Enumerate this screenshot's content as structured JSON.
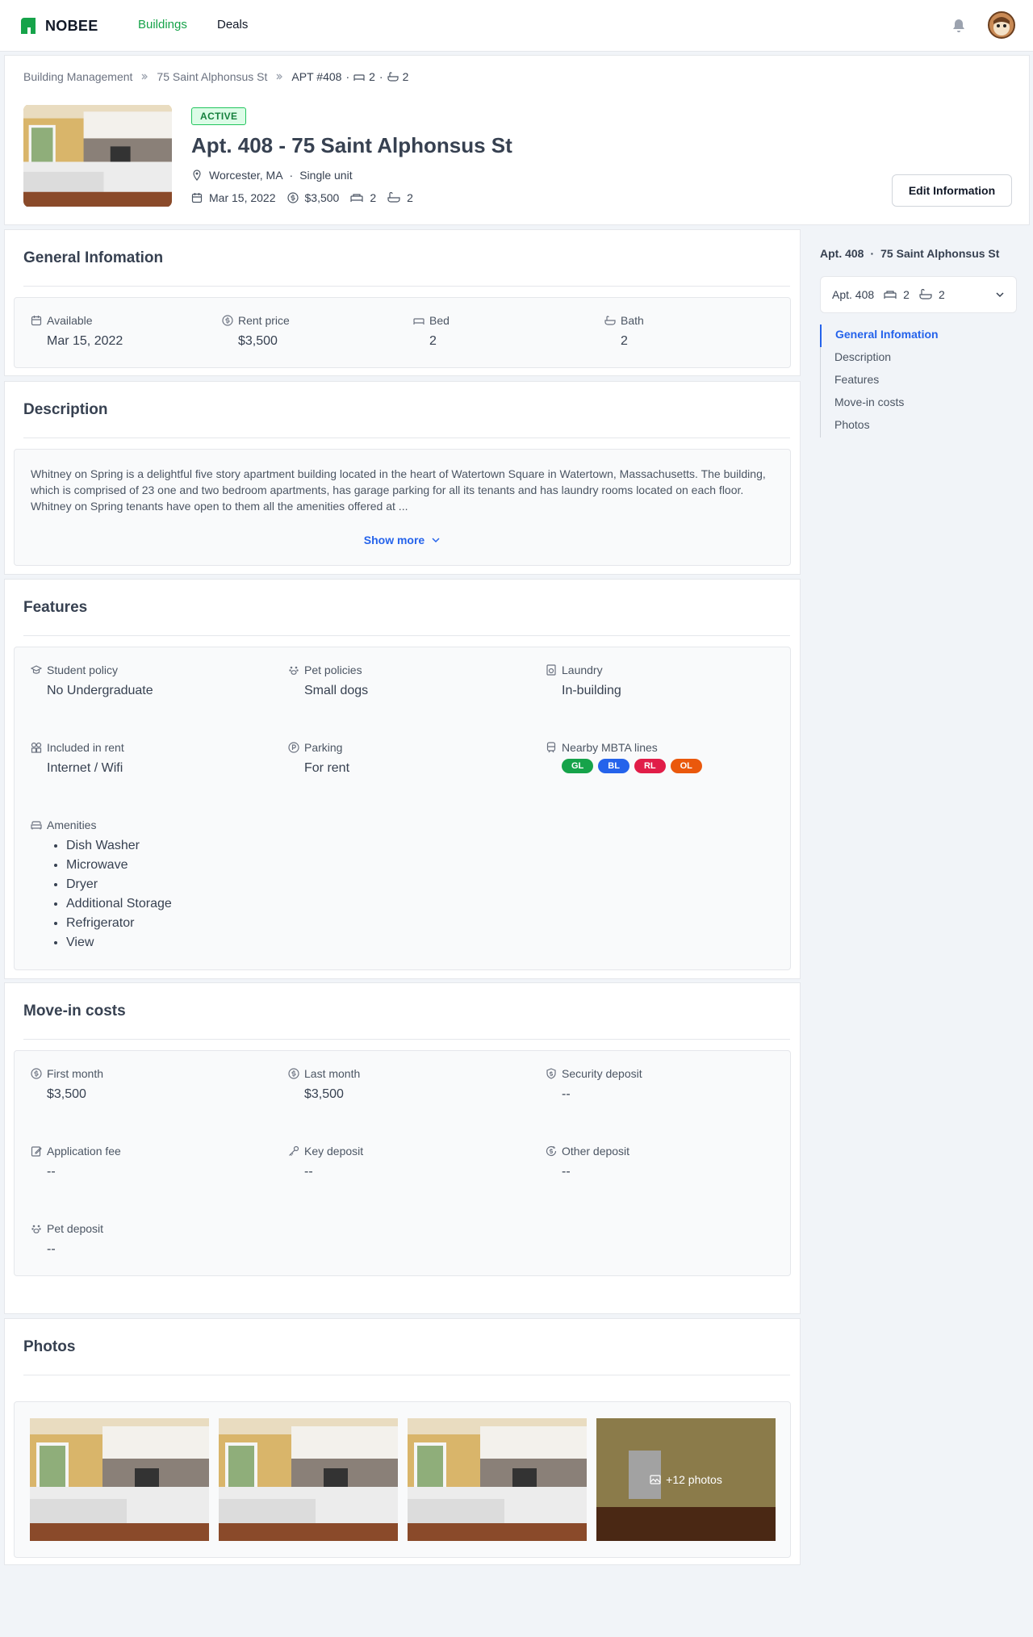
{
  "app": {
    "brand": "NOBEE"
  },
  "nav": {
    "buildings": "Buildings",
    "deals": "Deals"
  },
  "breadcrumb": {
    "level1": "Building Management",
    "level2": "75 Saint Alphonsus St",
    "current": "APT #408",
    "sep": "·",
    "beds": "2",
    "baths": "2"
  },
  "unit": {
    "status": "ACTIVE",
    "title": "Apt. 408 - 75 Saint Alphonsus St",
    "location": "Worcester, MA",
    "unit_type": "Single unit",
    "sep": "·",
    "date": "Mar 15, 2022",
    "price": "$3,500",
    "beds": "2",
    "baths": "2",
    "edit_label": "Edit Information"
  },
  "general": {
    "title": "General Infomation",
    "fields": [
      {
        "label": "Available",
        "value": "Mar 15, 2022"
      },
      {
        "label": "Rent price",
        "value": "$3,500"
      },
      {
        "label": "Bed",
        "value": "2"
      },
      {
        "label": "Bath",
        "value": "2"
      }
    ]
  },
  "description": {
    "title": "Description",
    "text": "Whitney on Spring is a delightful five story apartment building located in the heart of Watertown Square in Watertown, Massachusetts. The building, which is comprised of 23 one and two bedroom apartments, has garage parking for all its tenants and has laundry rooms located on each floor. Whitney on Spring tenants have open to them all the amenities offered at ...",
    "show_more": "Show more"
  },
  "features": {
    "title": "Features",
    "student_policy": {
      "label": "Student policy",
      "value": "No Undergraduate"
    },
    "pet_policies": {
      "label": "Pet policies",
      "value": "Small dogs"
    },
    "laundry": {
      "label": "Laundry",
      "value": "In-building"
    },
    "included": {
      "label": "Included in rent",
      "value": "Internet / Wifi"
    },
    "parking": {
      "label": "Parking",
      "value": "For rent"
    },
    "mbta": {
      "label": "Nearby MBTA lines",
      "lines": [
        {
          "code": "GL",
          "color": "#16a34a"
        },
        {
          "code": "BL",
          "color": "#2563eb"
        },
        {
          "code": "RL",
          "color": "#e11d48"
        },
        {
          "code": "OL",
          "color": "#ea580c"
        }
      ]
    },
    "amenities": {
      "label": "Amenities",
      "items": [
        "Dish Washer",
        "Microwave",
        "Dryer",
        "Additional Storage",
        "Refrigerator",
        "View"
      ]
    }
  },
  "movein": {
    "title": "Move-in costs",
    "first_month": {
      "label": "First month",
      "value": "$3,500"
    },
    "last_month": {
      "label": "Last month",
      "value": "$3,500"
    },
    "security_deposit": {
      "label": "Security deposit",
      "value": "--"
    },
    "application_fee": {
      "label": "Application fee",
      "value": "--"
    },
    "key_deposit": {
      "label": "Key deposit",
      "value": "--"
    },
    "other_deposit": {
      "label": "Other deposit",
      "value": "--"
    },
    "pet_deposit": {
      "label": "Pet deposit",
      "value": "--"
    }
  },
  "photos": {
    "title": "Photos",
    "more_label": "+12 photos"
  },
  "sidebar": {
    "unit": "Apt. 408",
    "sep": "·",
    "building": "75 Saint Alphonsus St",
    "select_unit": "Apt. 408",
    "select_beds": "2",
    "select_baths": "2",
    "toc": [
      "General Infomation",
      "Description",
      "Features",
      "Move-in costs",
      "Photos"
    ]
  },
  "colors": {
    "brand": "#16a34a",
    "accent": "#2563eb",
    "active_badge_bg": "#dcfce7"
  }
}
